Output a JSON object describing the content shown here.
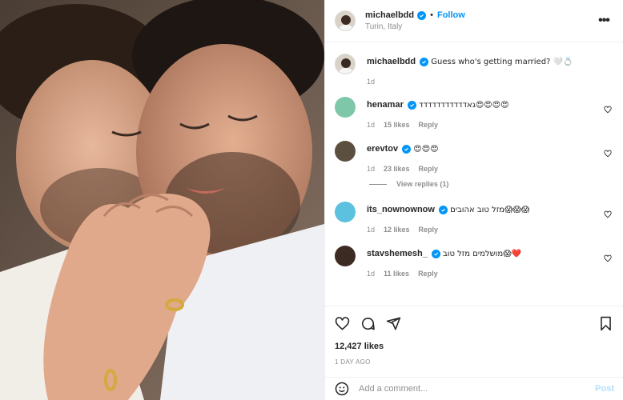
{
  "post": {
    "author": "michaelbdd",
    "follow_label": "Follow",
    "location": "Turin, Italy",
    "more_label": "•••",
    "caption": "Guess who's getting married? 🤍💍",
    "caption_time": "1d"
  },
  "comments": [
    {
      "user": "henamar",
      "text": "גאדדדדדדדדדדד😍😍😍😍",
      "time": "1d",
      "likes": "15 likes",
      "reply": "Reply",
      "verified": true
    },
    {
      "user": "erevtov",
      "text": "😍😍😍",
      "time": "1d",
      "likes": "23 likes",
      "reply": "Reply",
      "verified": true
    },
    {
      "user": "its_nownownow",
      "text": "מזל טוב אהובים😱😱😱",
      "time": "1d",
      "likes": "12 likes",
      "reply": "Reply",
      "verified": true
    },
    {
      "user": "stavshemesh_",
      "text": "מושלמים מזל טוב😱❤️",
      "time": "1d",
      "likes": "11 likes",
      "reply": "Reply",
      "verified": true
    }
  ],
  "view_replies": "View replies (1)",
  "footer": {
    "likes": "12,427 likes",
    "date": "1 DAY AGO",
    "comment_placeholder": "Add a comment...",
    "post_label": "Post"
  },
  "colors": {
    "accent": "#0095f6",
    "muted": "#8e8e8e",
    "text": "#262626"
  },
  "icons": [
    "heart-icon",
    "comment-icon",
    "share-icon",
    "bookmark-icon",
    "emoji-icon",
    "more-icon",
    "verified-icon"
  ]
}
